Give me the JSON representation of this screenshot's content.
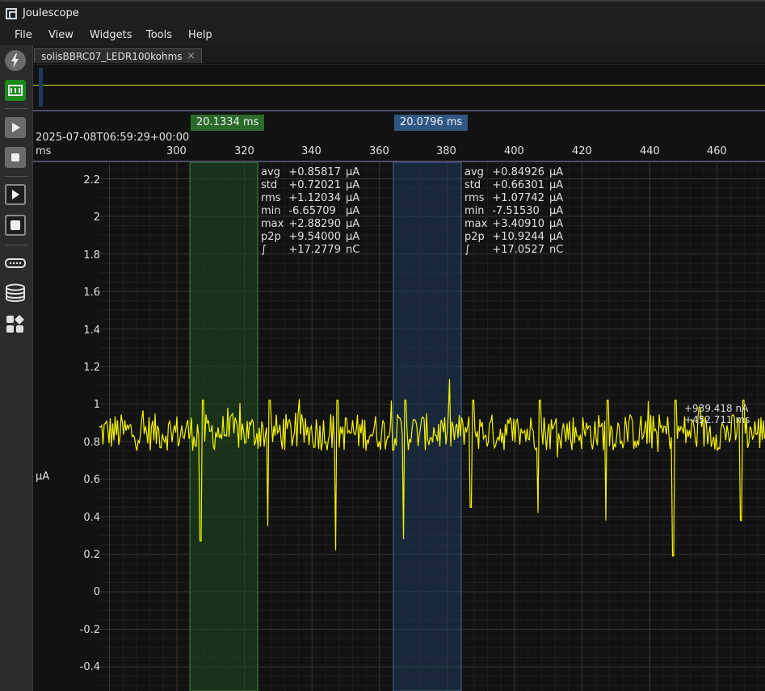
{
  "window": {
    "title": "Joulescope"
  },
  "menu": [
    "File",
    "View",
    "Widgets",
    "Tools",
    "Help"
  ],
  "sidebar": {
    "icons": [
      "power-icon",
      "waveform-widget-icon",
      "play-icon",
      "stop-icon",
      "record-play-icon",
      "record-stop-icon",
      "device-icon",
      "storage-icon",
      "widgets-icon"
    ]
  },
  "tab": {
    "label": "solisBBRC07_LEDR100kohms",
    "close": "×"
  },
  "xaxis": {
    "timestamp": "2025-07-08T06:59:29+00:00",
    "unit": "ms",
    "ticks": [
      "300",
      "320",
      "340",
      "360",
      "380",
      "400",
      "420",
      "440",
      "460"
    ]
  },
  "markers": [
    {
      "label": "20.1334 ms",
      "color": "#2a6b2a"
    },
    {
      "label": "20.0796 ms",
      "color": "#2f5783"
    }
  ],
  "yaxis": {
    "unit": "µA",
    "ticks": [
      "2.2",
      "2",
      "1.8",
      "1.6",
      "1.4",
      "1.2",
      "1",
      "0.8",
      "0.6",
      "0.4",
      "0.2",
      "0",
      "-0.2",
      "-0.4"
    ]
  },
  "stats": [
    {
      "rows": [
        {
          "name": "avg",
          "value": "+0.85817",
          "unit": "µA"
        },
        {
          "name": "std",
          "value": "+0.72021",
          "unit": "µA"
        },
        {
          "name": "rms",
          "value": "+1.12034",
          "unit": "µA"
        },
        {
          "name": "min",
          "value": "-6.65709",
          "unit": "µA"
        },
        {
          "name": "max",
          "value": "+2.88290",
          "unit": "µA"
        },
        {
          "name": "p2p",
          "value": "+9.54000",
          "unit": "µA"
        },
        {
          "name": "∫",
          "value": "+17.2779",
          "unit": "nC"
        }
      ]
    },
    {
      "rows": [
        {
          "name": "avg",
          "value": "+0.84926",
          "unit": "µA"
        },
        {
          "name": "std",
          "value": "+0.66301",
          "unit": "µA"
        },
        {
          "name": "rms",
          "value": "+1.07742",
          "unit": "µA"
        },
        {
          "name": "min",
          "value": "-7.51530",
          "unit": "µA"
        },
        {
          "name": "max",
          "value": "+3.40910",
          "unit": "µA"
        },
        {
          "name": "p2p",
          "value": "+10.9244",
          "unit": "µA"
        },
        {
          "name": "∫",
          "value": "+17.0527",
          "unit": "nC"
        }
      ]
    }
  ],
  "readout": {
    "current": "+939.418 nA",
    "time": "+452.711 ms"
  },
  "colors": {
    "trace": "#f4f400",
    "marker1": "#2a6b2a",
    "marker2": "#2f5783",
    "grid": "#303030"
  }
}
